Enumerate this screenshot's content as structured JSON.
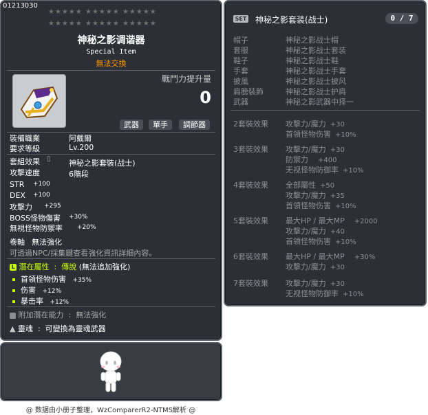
{
  "item": {
    "code": "01213030",
    "star_rows": [
      "★★★★★  ★★★★★  ★★★★★",
      "★★★★★  ★★★★★  ★★★★★"
    ],
    "name": "神秘之影调谐器",
    "type_label": "Special Item",
    "trade_status": "無法交換",
    "combat_power_label": "戰鬥力提升量",
    "combat_power_value": "0",
    "tags": [
      "武器",
      "單手",
      "調節器"
    ],
    "job_label": "裝備職業",
    "job_value": "阿戴爾",
    "level_label": "要求等級",
    "level_value": "Lv.200",
    "set_effect_label": "套組效果",
    "set_effect_value": "神秘之影套裝(战士)",
    "speed_label": "攻擊速度",
    "speed_value": "6階段",
    "stats": [
      {
        "label": "STR",
        "value": "+100"
      },
      {
        "label": "DEX",
        "value": "+100"
      },
      {
        "label": "攻擊力",
        "value": "+295"
      },
      {
        "label": "BOSS怪物傷害",
        "value": "+30%"
      },
      {
        "label": "無視怪物防禦率",
        "value": "+20%"
      }
    ],
    "scroll_label": "卷軸",
    "scroll_value": "無法強化",
    "npc_note": "可透過NPC/採集鍵查看強化資訊詳細內容。",
    "potential_label": "潛在屬性",
    "potential_grade": "傳說",
    "potential_note": "(無法追加強化)",
    "potentials": [
      {
        "label": "首領怪物伤害",
        "value": "+35%"
      },
      {
        "label": "伤害",
        "value": "+12%"
      },
      {
        "label": "暴击率",
        "value": "+12%"
      }
    ],
    "additional_label": "附加潛在能力",
    "additional_value": "無法強化",
    "soul_label": "靈魂",
    "soul_value": "可變換為靈魂武器"
  },
  "set": {
    "badge": "SET",
    "title": "神秘之影套装(战士)",
    "count": "0 / 7",
    "pieces": [
      {
        "slot": "帽子",
        "name": "神秘之影战士帽"
      },
      {
        "slot": "套服",
        "name": "神秘之影战士套装"
      },
      {
        "slot": "鞋子",
        "name": "神秘之影战士鞋"
      },
      {
        "slot": "手套",
        "name": "神秘之影战士手套"
      },
      {
        "slot": "披風",
        "name": "神秘之影战士披风"
      },
      {
        "slot": "肩膀裝飾",
        "name": "神秘之影战士护肩"
      },
      {
        "slot": "武器",
        "name": "神秘之影武器中择一"
      }
    ],
    "bonuses": [
      {
        "label": "2套裝效果",
        "lines": [
          {
            "text": "攻擊力/魔力",
            "num": "+30"
          },
          {
            "text": "首領怪物伤害",
            "num": "+10%"
          }
        ]
      },
      {
        "label": "3套裝效果",
        "lines": [
          {
            "text": "攻擊力/魔力",
            "num": "+30"
          },
          {
            "text": "防禦力",
            "num": "+400"
          },
          {
            "text": "无视怪物防御率",
            "num": "+10%"
          }
        ]
      },
      {
        "label": "4套裝效果",
        "lines": [
          {
            "text": "全部屬性",
            "num": "+50"
          },
          {
            "text": "攻擊力/魔力",
            "num": "+35"
          },
          {
            "text": "首領怪物伤害",
            "num": "+10%"
          }
        ]
      },
      {
        "label": "5套裝效果",
        "lines": [
          {
            "text": "最大HP / 最大MP",
            "num": "+2000"
          },
          {
            "text": "攻擊力/魔力",
            "num": "+40"
          },
          {
            "text": "首領怪物伤害",
            "num": "+10%"
          }
        ]
      },
      {
        "label": "6套裝效果",
        "lines": [
          {
            "text": "最大HP / 最大MP",
            "num": "+30%"
          },
          {
            "text": "攻擊力/魔力",
            "num": "+30"
          }
        ]
      },
      {
        "label": "7套裝效果",
        "lines": [
          {
            "text": "攻擊力/魔力",
            "num": "+30"
          },
          {
            "text": "无视怪物防御率",
            "num": "+10%"
          }
        ]
      }
    ]
  },
  "footer": "@ 数据由小册子整理，WzComparerR2-NTMS解析 @",
  "colors": {
    "panel": "#2c3036",
    "legendary": "#c8ff00",
    "untradeable": "#ff9900"
  },
  "icons": [
    "weapon-item-icon",
    "lock-icon",
    "potential-legend-icon",
    "soul-flame-icon",
    "avatar-figure-icon"
  ]
}
